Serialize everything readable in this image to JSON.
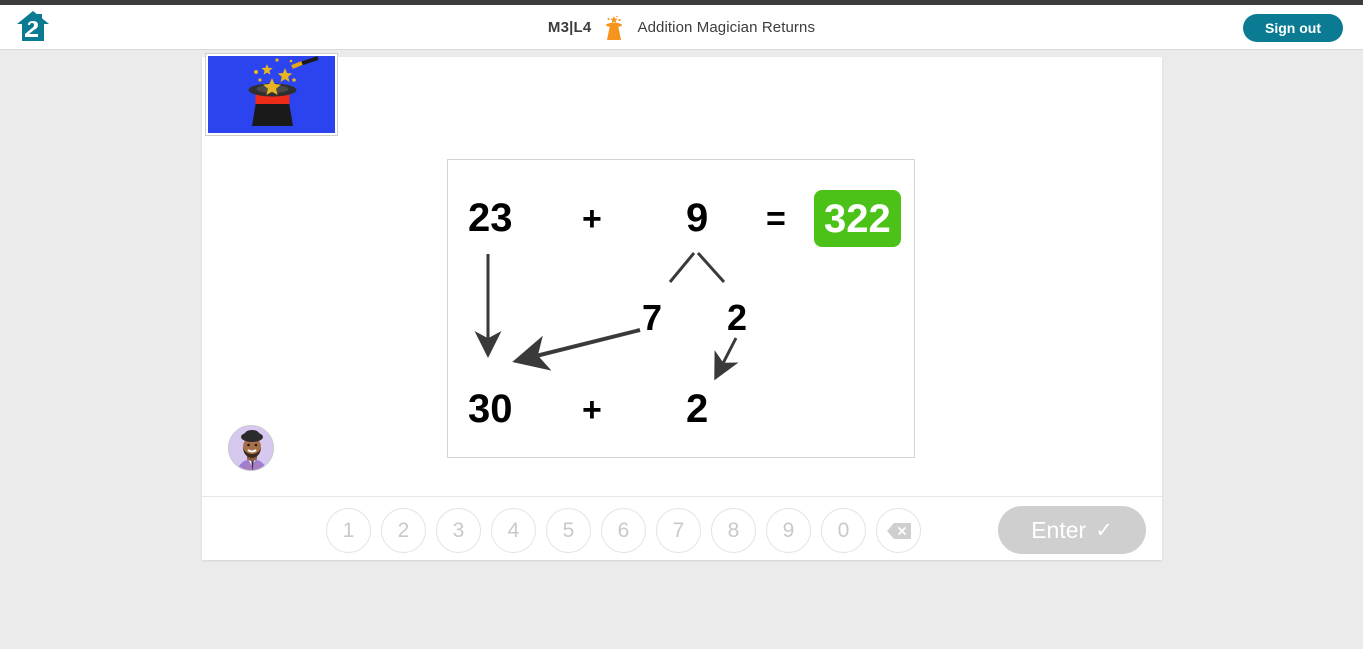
{
  "header": {
    "logo_icon": "house-two-logo",
    "lesson_code": "M3|L4",
    "hat_icon": "magician-hat-icon",
    "lesson_title": "Addition Magician Returns",
    "signout_label": "Sign out",
    "accent_color": "#0a7b93",
    "strip_color": "#3c3c3c"
  },
  "work_area": {
    "thumbnail_alt": "magic-hat-illustration",
    "avatar_alt": "student-avatar"
  },
  "problem": {
    "augend": "23",
    "operator_top": "+",
    "addend": "9",
    "equals": "=",
    "answer": "322",
    "answer_color": "#4cc218",
    "part_left": "7",
    "part_right": "2",
    "result_left": "30",
    "operator_bottom": "+",
    "result_right": "2"
  },
  "keypad": {
    "keys": [
      "1",
      "2",
      "3",
      "4",
      "5",
      "6",
      "7",
      "8",
      "9",
      "0"
    ],
    "backspace_icon": "backspace-icon",
    "enter_label": "Enter",
    "enter_check": "✓",
    "disabled_color": "#cfcfcf"
  }
}
